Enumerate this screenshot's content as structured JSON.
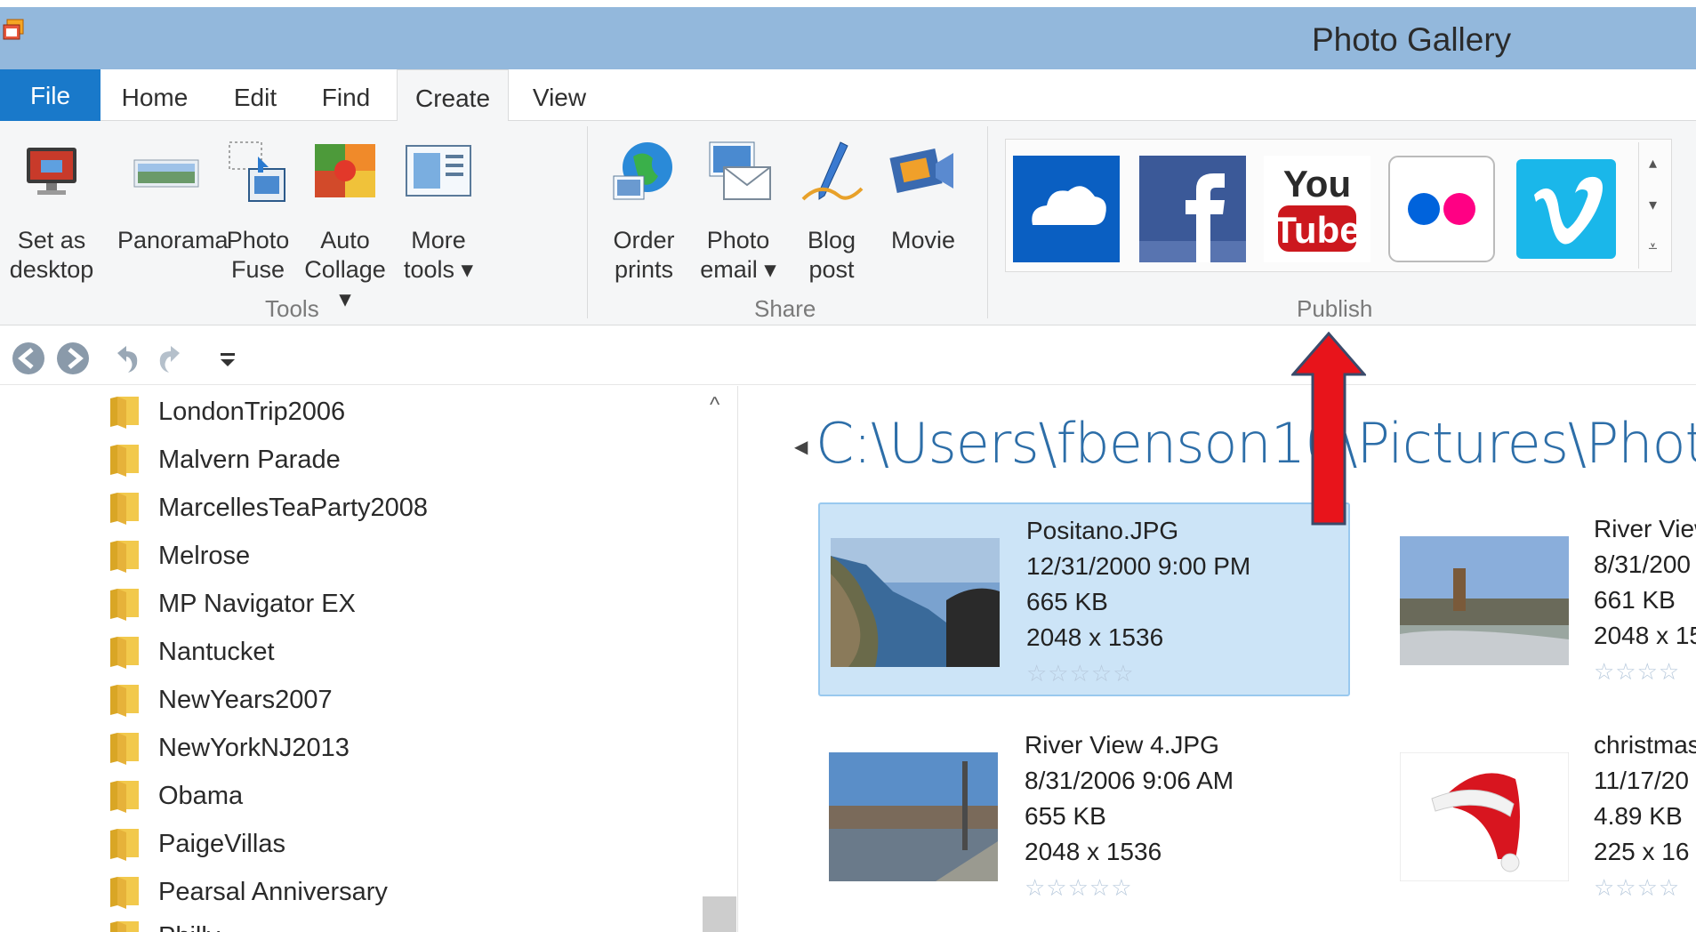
{
  "window": {
    "title": "Photo Gallery"
  },
  "tabs": [
    {
      "label": "File"
    },
    {
      "label": "Home"
    },
    {
      "label": "Edit"
    },
    {
      "label": "Find"
    },
    {
      "label": "Create"
    },
    {
      "label": "View"
    }
  ],
  "active_tab": "Create",
  "ribbon": {
    "tools": {
      "group_label": "Tools",
      "buttons": [
        {
          "label": "Set as\ndesktop",
          "icon": "monitor-icon"
        },
        {
          "label": "Panorama",
          "icon": "panorama-icon"
        },
        {
          "label": "Photo\nFuse",
          "icon": "photo-fuse-icon"
        },
        {
          "label": "Auto\nCollage ▾",
          "icon": "collage-icon"
        },
        {
          "label": "More\ntools ▾",
          "icon": "more-tools-icon"
        }
      ]
    },
    "share": {
      "group_label": "Share",
      "buttons": [
        {
          "label": "Order\nprints",
          "icon": "globe-icon"
        },
        {
          "label": "Photo\nemail ▾",
          "icon": "email-icon"
        },
        {
          "label": "Blog\npost",
          "icon": "pen-icon"
        },
        {
          "label": "Movie",
          "icon": "film-icon"
        }
      ]
    },
    "publish": {
      "group_label": "Publish",
      "services": [
        {
          "name": "OneDrive",
          "icon": "onedrive-icon",
          "color": "#0a5fc2"
        },
        {
          "name": "Facebook",
          "icon": "facebook-icon",
          "color": "#3b5998"
        },
        {
          "name": "YouTube",
          "icon": "youtube-icon",
          "color": "#cc181e"
        },
        {
          "name": "Flickr",
          "icon": "flickr-icon",
          "color": "#0063dc"
        },
        {
          "name": "Vimeo",
          "icon": "vimeo-icon",
          "color": "#1ab7ea"
        }
      ]
    }
  },
  "folders": [
    "LondonTrip2006",
    "Malvern Parade",
    "MarcellesTeaParty2008",
    "Melrose",
    "MP Navigator EX",
    "Nantucket",
    "NewYears2007",
    "NewYorkNJ2013",
    "Obama",
    "PaigeVillas",
    "Pearsal Anniversary",
    "Philly"
  ],
  "content": {
    "path": "C:\\Users\\fbenson10\\Pictures\\Phot",
    "photos": [
      {
        "name": "Positano.JPG",
        "date": "12/31/2000 9:00 PM",
        "size": "665 KB",
        "dimensions": "2048 x 1536",
        "rating": "☆☆☆☆☆",
        "selected": true
      },
      {
        "name": "River View",
        "date": "8/31/200",
        "size": "661 KB",
        "dimensions": "2048 x 15",
        "rating": "☆☆☆☆",
        "selected": false
      },
      {
        "name": "River View 4.JPG",
        "date": "8/31/2006 9:06 AM",
        "size": "655 KB",
        "dimensions": "2048 x 1536",
        "rating": "☆☆☆☆☆",
        "selected": false
      },
      {
        "name": "christmas",
        "date": "11/17/20",
        "size": "4.89 KB",
        "dimensions": "225 x 16",
        "rating": "☆☆☆☆",
        "selected": false
      }
    ]
  },
  "colors": {
    "titlebar": "#93b8dc",
    "file_tab": "#1979ca",
    "selection": "#cce4f7",
    "path_text": "#2d6ea8",
    "annotation_arrow": "#e8141b"
  }
}
